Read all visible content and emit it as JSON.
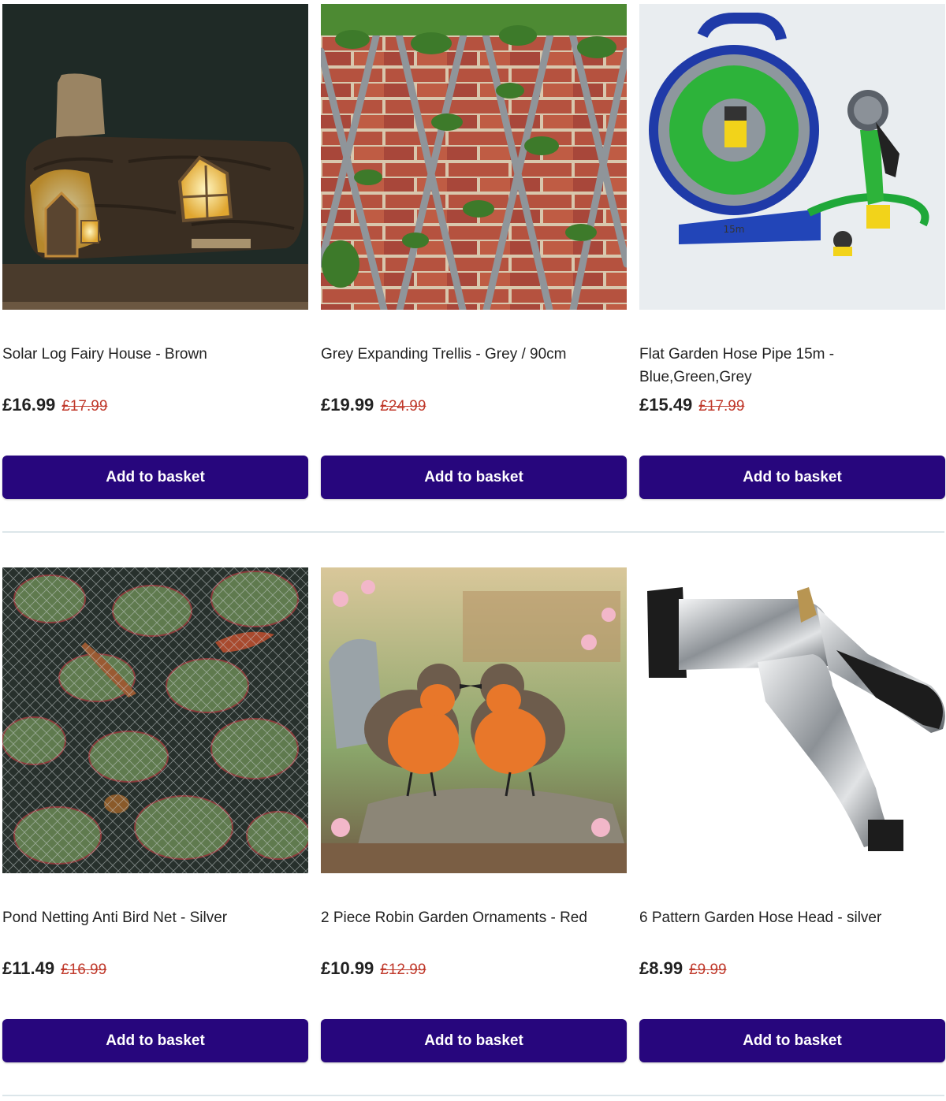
{
  "accent_color": "#27067d",
  "sale_color": "#c0392b",
  "products": [
    {
      "name": "Solar Log Fairy House - Brown",
      "price": "£16.99",
      "was_price": "£17.99",
      "button_label": "Add to basket",
      "image_icon": "fairy-house-image"
    },
    {
      "name": "Grey Expanding Trellis - Grey / 90cm",
      "price": "£19.99",
      "was_price": "£24.99",
      "button_label": "Add to basket",
      "image_icon": "trellis-image"
    },
    {
      "name": "Flat Garden Hose Pipe 15m - Blue,Green,Grey",
      "price": "£15.49",
      "was_price": "£17.99",
      "button_label": "Add to basket",
      "image_icon": "hose-reel-image",
      "image_text": "15m"
    },
    {
      "name": "Pond Netting Anti Bird Net - Silver",
      "price": "£11.49",
      "was_price": "£16.99",
      "button_label": "Add to basket",
      "image_icon": "pond-net-image"
    },
    {
      "name": "2 Piece Robin Garden Ornaments - Red",
      "price": "£10.99",
      "was_price": "£12.99",
      "button_label": "Add to basket",
      "image_icon": "robin-ornaments-image"
    },
    {
      "name": "6 Pattern Garden Hose Head - silver",
      "price": "£8.99",
      "was_price": "£9.99",
      "button_label": "Add to basket",
      "image_icon": "hose-gun-image"
    }
  ]
}
